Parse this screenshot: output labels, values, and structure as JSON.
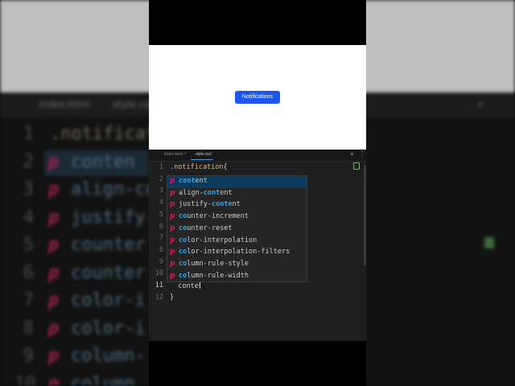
{
  "background": {
    "tabs": [
      "index.html",
      "style.css"
    ],
    "lines": [
      {
        "num": "1",
        "text": ".notificat"
      },
      {
        "num": "2",
        "text": "conten"
      },
      {
        "num": "3",
        "text": "align-co"
      },
      {
        "num": "4",
        "text": "justify-"
      },
      {
        "num": "5",
        "text": "counter"
      },
      {
        "num": "6",
        "text": "counter"
      },
      {
        "num": "7",
        "text": "color-i"
      },
      {
        "num": "8",
        "text": "color-i"
      },
      {
        "num": "9",
        "text": "column-"
      },
      {
        "num": "10",
        "text": "column"
      }
    ],
    "kind_icon": "p"
  },
  "preview": {
    "button_label": "Notifications",
    "colors": {
      "button": "#1a57ea",
      "background": "#ffffff"
    }
  },
  "editor": {
    "tabs": [
      {
        "label": "index.html",
        "active": false
      },
      {
        "label": "style.css",
        "active": true
      }
    ],
    "toolbar": {
      "plus": "+",
      "more": "⋮"
    },
    "lines": [
      {
        "num": "1",
        "text": ".notification{"
      },
      {
        "num": "2",
        "text": ""
      },
      {
        "num": "3",
        "text": ""
      },
      {
        "num": "4",
        "text": ""
      },
      {
        "num": "5",
        "text": ""
      },
      {
        "num": "6",
        "text": ""
      },
      {
        "num": "7",
        "text": ""
      },
      {
        "num": "8",
        "text": ""
      },
      {
        "num": "9",
        "text": ""
      },
      {
        "num": "10",
        "text": ""
      },
      {
        "num": "11",
        "text": "  conte"
      },
      {
        "num": "12",
        "text": "}"
      }
    ],
    "selector": ".notification",
    "open_brace": "{",
    "typed": "conte",
    "close_brace": "}"
  },
  "suggestions": {
    "kind_icon": "p",
    "items": [
      {
        "pre": "",
        "match": "cont",
        "post": "ent",
        "active": true
      },
      {
        "pre": "align-",
        "match": "cont",
        "post": "ent",
        "active": false
      },
      {
        "pre": "justify-",
        "match": "conte",
        "post": "nt",
        "active": false
      },
      {
        "pre": "",
        "match": "co",
        "post": "unter-increment",
        "pre2": "",
        "active": false
      },
      {
        "pre": "",
        "match": "co",
        "post": "unter-reset",
        "active": false
      },
      {
        "pre": "",
        "match": "co",
        "post": "lor-interpolation",
        "active": false
      },
      {
        "pre": "",
        "match": "co",
        "post": "lor-interpolation-filters",
        "active": false
      },
      {
        "pre": "",
        "match": "co",
        "post": "lumn-rule-style",
        "active": false
      },
      {
        "pre": "",
        "match": "co",
        "post": "lumn-rule-width",
        "active": false
      }
    ]
  }
}
